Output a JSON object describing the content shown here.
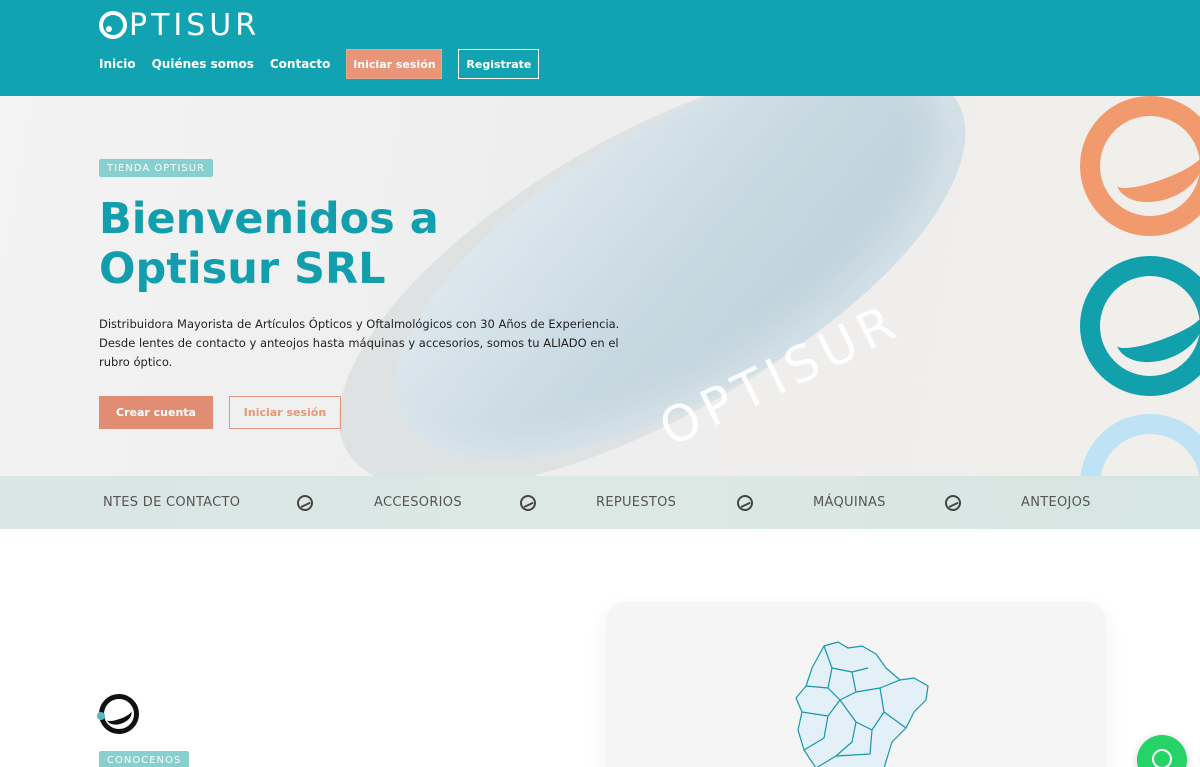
{
  "header": {
    "logo_text": "PTISUR",
    "nav": [
      {
        "label": "Inicio"
      },
      {
        "label": "Quiénes somos"
      },
      {
        "label": "Contacto"
      }
    ],
    "login_label": "Iniciar sesión",
    "register_label": "Registrate"
  },
  "hero": {
    "tag": "TIENDA OPTISUR",
    "title": "Bienvenidos a Optisur SRL",
    "description": "Distribuidora Mayorista de Artículos Ópticos y Oftalmológicos con 30 Años de Experiencia. Desde lentes de contacto y anteojos hasta máquinas y accesorios, somos tu ALIADO en el rubro óptico.",
    "create_account_label": "Crear cuenta",
    "login_label": "Iniciar sesión",
    "case_brand": "OPTISUR"
  },
  "categories": [
    {
      "label": "NTES DE CONTACTO"
    },
    {
      "label": "ACCESORIOS"
    },
    {
      "label": "REPUESTOS"
    },
    {
      "label": "MÁQUINAS"
    },
    {
      "label": "ANTEOJOS"
    }
  ],
  "about": {
    "tag": "CONOCENOS"
  },
  "colors": {
    "brand_teal": "#12a3b2",
    "accent_coral": "#e8957a",
    "tag_bg": "#88cfd0",
    "whatsapp_green": "#25d366"
  },
  "icons": {
    "logo": "optisur-logo-icon",
    "category_separator": "optisur-s-icon",
    "whatsapp": "whatsapp-icon"
  }
}
